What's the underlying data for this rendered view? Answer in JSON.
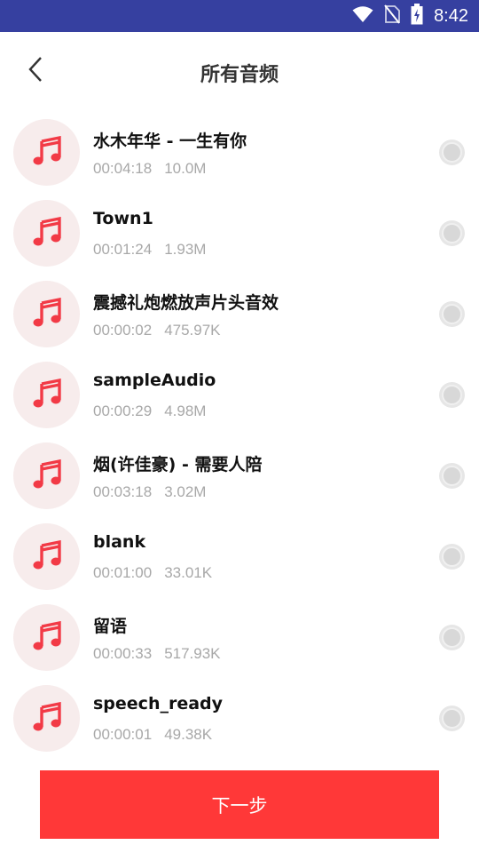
{
  "status_bar": {
    "time": "8:42",
    "icons": [
      "wifi-icon",
      "no-sim-icon",
      "battery-icon"
    ]
  },
  "header": {
    "title": "所有音频",
    "back_icon": "chevron-left-icon"
  },
  "audio_list": [
    {
      "title": "水木年华 - 一生有你",
      "duration": "00:04:18",
      "size": "10.0M"
    },
    {
      "title": "Town1",
      "duration": "00:01:24",
      "size": "1.93M"
    },
    {
      "title": "震撼礼炮燃放声片头音效",
      "duration": "00:00:02",
      "size": "475.97K"
    },
    {
      "title": "sampleAudio",
      "duration": "00:00:29",
      "size": "4.98M"
    },
    {
      "title": "烟(许佳豪) - 需要人陪",
      "duration": "00:03:18",
      "size": "3.02M"
    },
    {
      "title": "blank",
      "duration": "00:01:00",
      "size": "33.01K"
    },
    {
      "title": "留语",
      "duration": "00:00:33",
      "size": "517.93K"
    },
    {
      "title": "speech_ready",
      "duration": "00:00:01",
      "size": "49.38K"
    }
  ],
  "footer": {
    "next_label": "下一步"
  },
  "colors": {
    "status_bar": "#3640a0",
    "accent": "#ff3838",
    "thumb_bg": "#f7ecec",
    "music_icon": "#f23a46"
  }
}
